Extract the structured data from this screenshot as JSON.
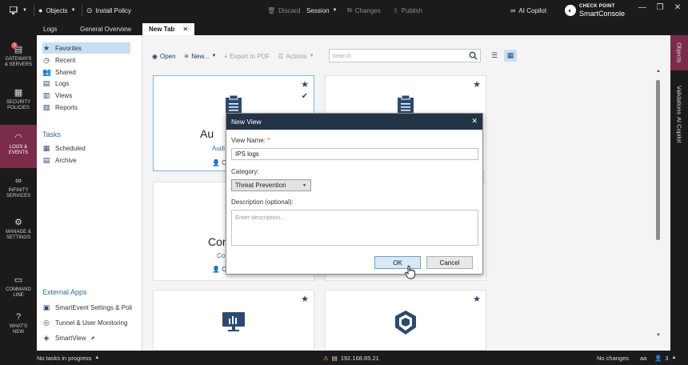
{
  "topbar": {
    "objects_label": "Objects",
    "install_policy_label": "Install Policy",
    "discard_label": "Discard",
    "session_label": "Session",
    "changes_label": "Changes",
    "publish_label": "Publish",
    "ai_copilot_label": "AI Copilot",
    "brand_top": "CHECK POINT",
    "brand_bottom": "SmartConsole"
  },
  "tabs": [
    {
      "label": "Logs"
    },
    {
      "label": "General Overview"
    },
    {
      "label": "New Tab"
    }
  ],
  "leftnav": [
    {
      "line1": "GATEWAYS",
      "line2": "& SERVERS",
      "badge": "3"
    },
    {
      "line1": "SECURITY",
      "line2": "POLICIES"
    },
    {
      "line1": "LOGS &",
      "line2": "EVENTS"
    },
    {
      "line1": "INFINITY",
      "line2": "SERVICES"
    },
    {
      "line1": "MANAGE &",
      "line2": "SETTINGS"
    },
    {
      "line1": "COMMAND",
      "line2": "LINE"
    },
    {
      "line1": "WHAT'S",
      "line2": "NEW"
    }
  ],
  "rightbar": {
    "objects": "Objects",
    "validations": "Validations",
    "ai_copilot": "AI Copilot"
  },
  "sidepanel": {
    "items": [
      {
        "label": "Favorites",
        "icon": "star-icon"
      },
      {
        "label": "Recent",
        "icon": "clock-icon"
      },
      {
        "label": "Shared",
        "icon": "people-icon"
      },
      {
        "label": "Logs",
        "icon": "document-icon"
      },
      {
        "label": "Views",
        "icon": "eye-icon"
      },
      {
        "label": "Reports",
        "icon": "report-icon"
      }
    ],
    "tasks_header": "Tasks",
    "tasks": [
      {
        "label": "Scheduled",
        "icon": "calendar-icon"
      },
      {
        "label": "Archive",
        "icon": "archive-icon"
      }
    ],
    "external_header": "External Apps",
    "external": [
      {
        "label": "SmartEvent Settings & Poli",
        "icon": "settings-icon"
      },
      {
        "label": "Tunnel & User Monitoring",
        "icon": "globe-icon"
      },
      {
        "label": "SmartView",
        "icon": "smartview-icon"
      }
    ]
  },
  "toolbar": {
    "open_label": "Open",
    "new_label": "New...",
    "export_label": "Export to PDF",
    "actions_label": "Actions",
    "search_placeholder": "Search"
  },
  "cards": [
    {
      "title": "Au",
      "sub": "Audi",
      "user": "C"
    },
    {
      "title": "",
      "sub": "",
      "user": ""
    },
    {
      "title": "Com",
      "sub": "Co",
      "user": "C"
    },
    {
      "title": "",
      "sub": "",
      "user": ""
    },
    {
      "title": "",
      "sub": "",
      "user": ""
    },
    {
      "title": "",
      "sub": "",
      "user": ""
    }
  ],
  "status": {
    "tasks": "No tasks in progress",
    "ip": "192.168.85.21",
    "changes": "No changes",
    "user_initials": "aa",
    "notif_count": "3"
  },
  "modal": {
    "title": "New View",
    "view_name_label": "View Name:",
    "required_mark": "*",
    "view_name_value": "IPS logs",
    "category_label": "Category:",
    "category_value": "Threat Prevention",
    "description_label": "Description (optional):",
    "description_placeholder": "Enter description...",
    "ok_label": "OK",
    "cancel_label": "Cancel"
  }
}
